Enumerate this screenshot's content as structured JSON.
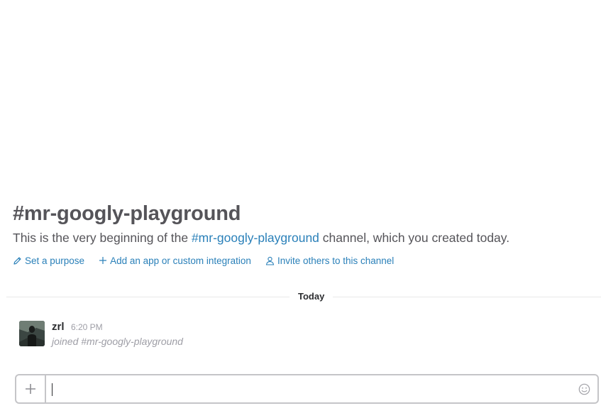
{
  "channel": {
    "title": "#mr-googly-playground",
    "intro_prefix": "This is the very beginning of the ",
    "intro_link": "#mr-googly-playground",
    "intro_suffix": " channel, which you created today."
  },
  "actions": [
    {
      "label": "Set a purpose",
      "icon": "pencil-icon"
    },
    {
      "label": "Add an app or custom integration",
      "icon": "plus-icon"
    },
    {
      "label": "Invite others to this channel",
      "icon": "person-icon"
    }
  ],
  "divider": {
    "label": "Today"
  },
  "message": {
    "sender": "zrl",
    "time": "6:20 PM",
    "text": "joined #mr-googly-playground"
  },
  "composer": {
    "value": "",
    "placeholder": ""
  },
  "colors": {
    "link": "#2a80b9",
    "muted": "#9e9ea6",
    "title": "#555459",
    "border": "#c5c5c8"
  }
}
